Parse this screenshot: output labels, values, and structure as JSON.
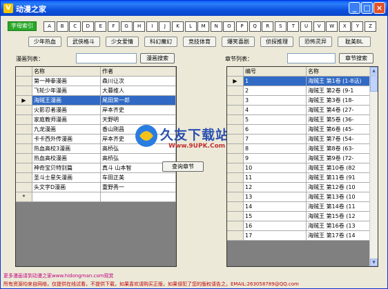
{
  "window": {
    "title": "动漫之家"
  },
  "index_button": "字母索引",
  "letters": [
    "A",
    "B",
    "C",
    "D",
    "E",
    "F",
    "G",
    "H",
    "I",
    "J",
    "K",
    "L",
    "M",
    "N",
    "O",
    "P",
    "Q",
    "R",
    "S",
    "T",
    "U",
    "V",
    "W",
    "X",
    "Y",
    "Z"
  ],
  "categories": [
    "少年热血",
    "武侠格斗",
    "少女爱情",
    "科幻魔幻",
    "竞技体育",
    "爆笑喜剧",
    "侦探推理",
    "恐怖灵异",
    "耽美BL"
  ],
  "left": {
    "list_label": "漫画列表：",
    "search_label": "漫画搜索",
    "columns": [
      "名称",
      "作者"
    ],
    "rows": [
      {
        "name": "第一神拳漫画",
        "author": "森川让次"
      },
      {
        "name": "飞轮少年漫画",
        "author": "大暮维人"
      },
      {
        "name": "海贼王漫画",
        "author": "尾田荣一郎"
      },
      {
        "name": "火影忍者漫画",
        "author": "岸本齐史"
      },
      {
        "name": "家庭教师漫画",
        "author": "天野明"
      },
      {
        "name": "九龙漫画",
        "author": "香山刚昌"
      },
      {
        "name": "卡卡西外传漫画",
        "author": "岸本齐史"
      },
      {
        "name": "热血高校3漫画",
        "author": "高桥弘"
      },
      {
        "name": "热血高校漫画",
        "author": "高桥弘"
      },
      {
        "name": "神奇宝贝特别篇",
        "author": "真斗 山本智"
      },
      {
        "name": "圣斗士星矢漫画",
        "author": "车田正美"
      },
      {
        "name": "头文字D漫画",
        "author": "重野秀一"
      }
    ],
    "selected_index": 2,
    "new_row_marker": "*"
  },
  "center": {
    "button": "查询章节"
  },
  "right": {
    "list_label": "章节列表：",
    "search_label": "章节搜索",
    "columns": [
      "编号",
      "名称"
    ],
    "rows": [
      {
        "id": "1",
        "name": "海贼王 第1卷 (1-8话)"
      },
      {
        "id": "2",
        "name": "海贼王 第2卷 (9-1"
      },
      {
        "id": "3",
        "name": "海贼王 第3卷 (18-"
      },
      {
        "id": "4",
        "name": "海贼王 第4卷 (27-"
      },
      {
        "id": "5",
        "name": "海贼王 第5卷 (36-"
      },
      {
        "id": "6",
        "name": "海贼王 第6卷 (45-"
      },
      {
        "id": "7",
        "name": "海贼王 第7卷 (54-"
      },
      {
        "id": "8",
        "name": "海贼王 第8卷 (63-"
      },
      {
        "id": "9",
        "name": "海贼王 第9卷 (72-"
      },
      {
        "id": "10",
        "name": "海贼王 第10卷 (82"
      },
      {
        "id": "11",
        "name": "海贼王 第11卷 (91"
      },
      {
        "id": "12",
        "name": "海贼王 第12卷 (10"
      },
      {
        "id": "13",
        "name": "海贼王 第13卷 (10"
      },
      {
        "id": "14",
        "name": "海贼王 第14卷 (11"
      },
      {
        "id": "15",
        "name": "海贼王 第15卷 (12"
      },
      {
        "id": "16",
        "name": "海贼王 第16卷 (13"
      },
      {
        "id": "17",
        "name": "海贼王 第17卷 (14"
      }
    ],
    "selected_index": 0
  },
  "watermark": {
    "text": "久友下载站",
    "url": "Www.9UPK.Com"
  },
  "footer": {
    "link": "更多漫画请到动漫之家www.hidongman.com观赏",
    "notice": "所有资源均来自网络，仅提供在线试看，不提供下载，如果喜欢请购买正版，如果侵犯了您的版权请告之，EMAIL:263058789@QQ.com"
  },
  "colors": {
    "selection": "#316ac5",
    "index_button": "#28a828",
    "titlebar": "#0a5ef7"
  }
}
